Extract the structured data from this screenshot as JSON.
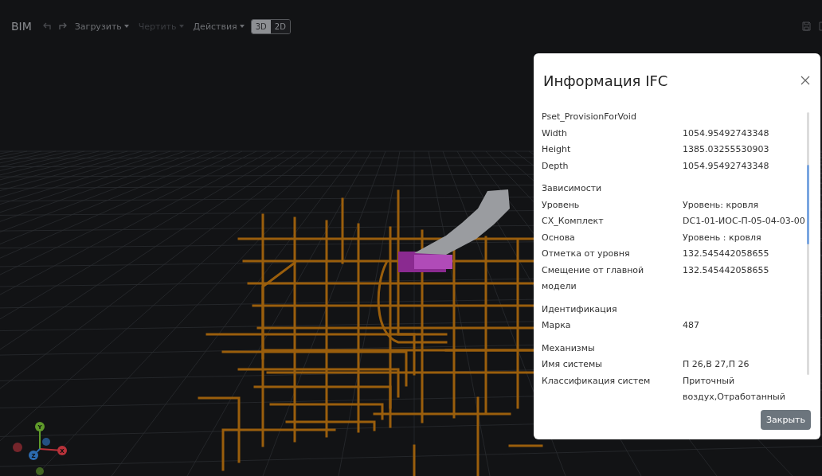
{
  "toolbar": {
    "brand": "BIM",
    "menus": [
      {
        "label": "Загрузить",
        "disabled": false
      },
      {
        "label": "Чертить",
        "disabled": true
      },
      {
        "label": "Действия",
        "disabled": false
      }
    ],
    "view_modes": [
      {
        "label": "3D",
        "selected": true
      },
      {
        "label": "2D",
        "selected": false
      }
    ]
  },
  "viewport": {
    "axes": [
      {
        "label": "X",
        "color": "#b8323a"
      },
      {
        "label": "Y",
        "color": "#5f9a2a"
      },
      {
        "label": "Z",
        "color": "#2c6bb0"
      }
    ]
  },
  "dialog": {
    "title": "Информация IFC",
    "groups": [
      {
        "title": "Pset_ProvisionForVoid",
        "rows": [
          {
            "name": "Width",
            "value": "1054.95492743348"
          },
          {
            "name": "Height",
            "value": "1385.03255530903"
          },
          {
            "name": "Depth",
            "value": "1054.95492743348"
          }
        ]
      },
      {
        "title": "Зависимости",
        "rows": [
          {
            "name": "Уровень",
            "value": "Уровень: кровля"
          },
          {
            "name": "СХ_Комплект",
            "value": "DC1-01-ИОС-П-05-04-03-00"
          },
          {
            "name": "Основа",
            "value": "Уровень : кровля"
          },
          {
            "name": "Отметка от уровня",
            "value": "132.545442058655"
          },
          {
            "name": "Смещение от главной модели",
            "value": "132.545442058655"
          }
        ]
      },
      {
        "title": "Идентификация",
        "rows": [
          {
            "name": "Марка",
            "value": "487"
          }
        ]
      },
      {
        "title": "Механизмы",
        "rows": [
          {
            "name": "Имя системы",
            "value": "П 26,В 27,П 26"
          },
          {
            "name": "Классификация систем",
            "value": "Приточный воздух,Отработанный"
          }
        ]
      }
    ],
    "close_button": "Закрыть"
  }
}
